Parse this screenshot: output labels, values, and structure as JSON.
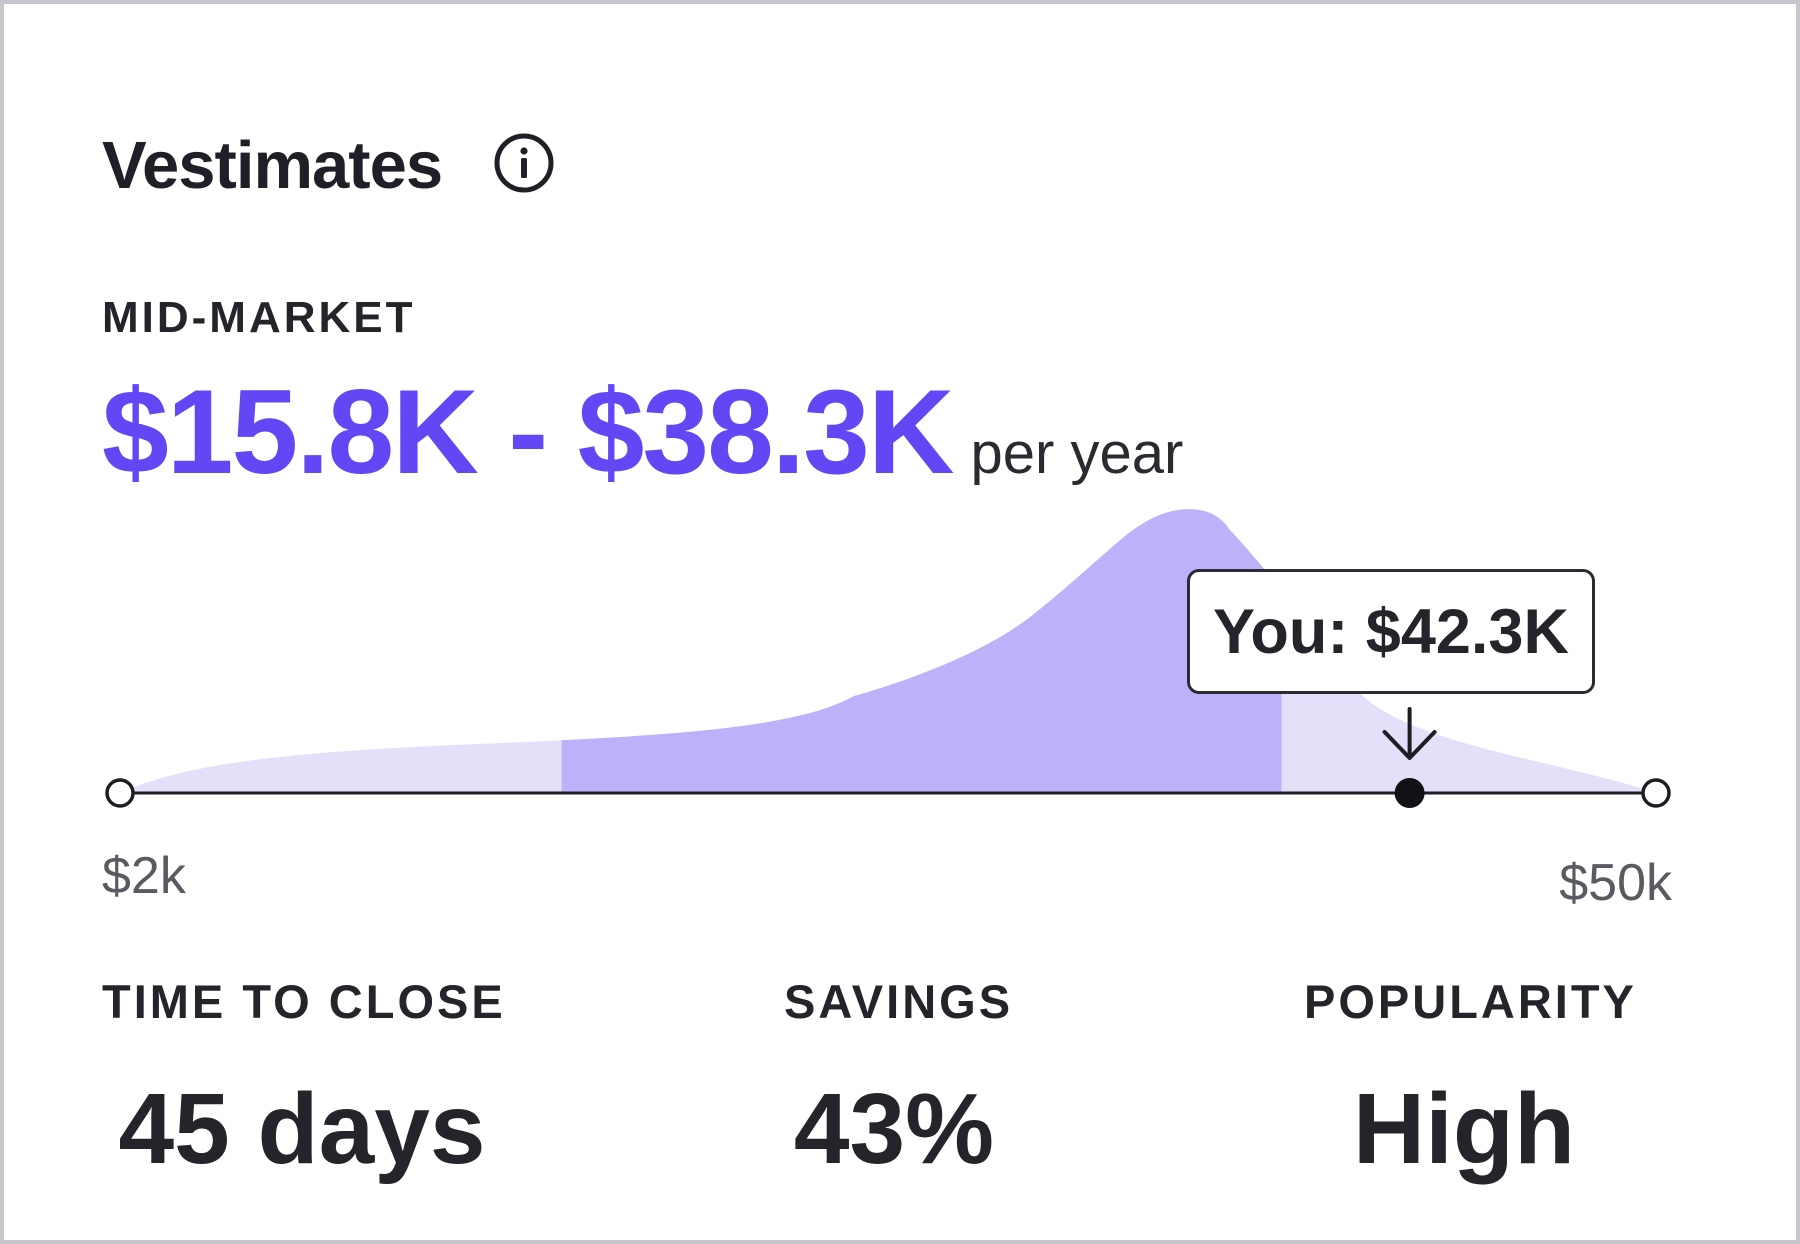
{
  "header": {
    "title": "Vestimates",
    "info_icon": "info-circle-icon"
  },
  "estimate": {
    "tier": "MID-MARKET",
    "range": "$15.8K - $38.3K",
    "unit": "per year"
  },
  "distribution": {
    "axis_min_label": "$2k",
    "axis_max_label": "$50k",
    "axis_min": 2,
    "axis_max": 50,
    "range_low": 15.8,
    "range_high": 38.3,
    "you_value": 42.3,
    "you_label": "You: $42.3K",
    "marker_icon": "arrow-down-icon",
    "colors": {
      "outer_fill": "#e4e0fa",
      "range_fill": "#bcb2fa",
      "accent": "#6247f5",
      "axis": "#1d1d24"
    }
  },
  "stats": {
    "time_to_close": {
      "label": "TIME TO CLOSE",
      "value": "45 days"
    },
    "savings": {
      "label": "SAVINGS",
      "value": "43%"
    },
    "popularity": {
      "label": "POPULARITY",
      "value": "High"
    }
  }
}
